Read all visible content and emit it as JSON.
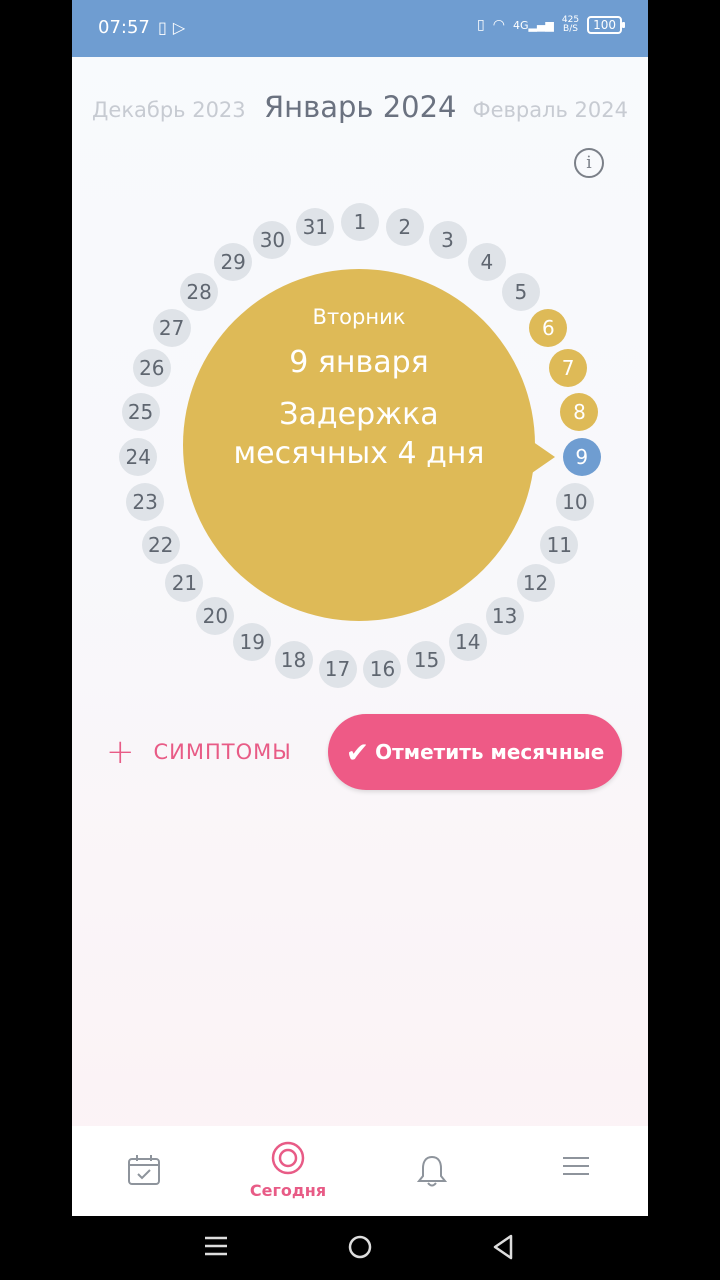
{
  "status_bar": {
    "time": "07:57",
    "left_icons": [
      "notification-icon",
      "play-store-icon"
    ],
    "right_icons": [
      "vibrate-icon",
      "wifi-icon",
      "signal-4g-icon"
    ],
    "network_badge": "4G",
    "net_speed_value": "425",
    "net_speed_unit": "B/S",
    "battery": "100"
  },
  "months": {
    "prev": "Декабрь 2023",
    "current": "Январь 2024",
    "next": "Февраль 2024"
  },
  "info_icon_glyph": "i",
  "calendar": {
    "days": [
      "1",
      "2",
      "3",
      "4",
      "5",
      "6",
      "7",
      "8",
      "9",
      "10",
      "11",
      "12",
      "13",
      "14",
      "15",
      "16",
      "17",
      "18",
      "19",
      "20",
      "21",
      "22",
      "23",
      "24",
      "25",
      "26",
      "27",
      "28",
      "29",
      "30",
      "31"
    ],
    "delay_days": [
      6,
      7,
      8
    ],
    "today": 9,
    "colors": {
      "delay": "#deba57",
      "today": "#6f9dd1",
      "default": "#dfe3e8"
    }
  },
  "bubble": {
    "weekday": "Вторник",
    "date": "9 января",
    "status": "Задержка месячных 4 дня"
  },
  "actions": {
    "symptoms_label": "СИМПТОМЫ",
    "mark_label": "Отметить месячные"
  },
  "bottom_nav": {
    "items": [
      {
        "icon": "calendar-icon",
        "label": ""
      },
      {
        "icon": "target-icon",
        "label": "Сегодня",
        "active": true
      },
      {
        "icon": "bell-icon",
        "label": ""
      },
      {
        "icon": "menu-icon",
        "label": ""
      }
    ]
  },
  "colors": {
    "accent_pink": "#ee5a86",
    "status_blue": "#6f9dd1",
    "gold": "#deba57"
  }
}
